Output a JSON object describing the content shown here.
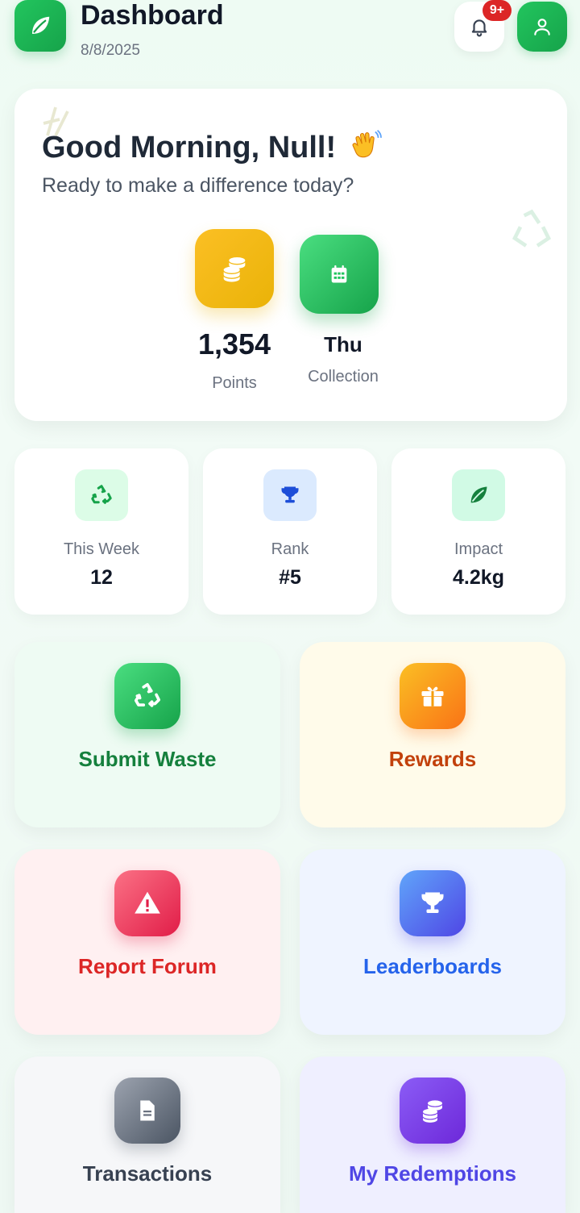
{
  "header": {
    "title": "Dashboard",
    "date": "8/8/2025",
    "notification_badge": "9+"
  },
  "greeting": {
    "title": "Good Morning, Null!",
    "subtitle": "Ready to make a difference today?",
    "points": {
      "value": "1,354",
      "label": "Points"
    },
    "collection": {
      "value": "Thu",
      "label": "Collection"
    }
  },
  "stats": [
    {
      "label": "This Week",
      "value": "12",
      "icon": "recycle-icon"
    },
    {
      "label": "Rank",
      "value": "#5",
      "icon": "trophy-icon"
    },
    {
      "label": "Impact",
      "value": "4.2kg",
      "icon": "leaf-icon"
    }
  ],
  "actions": [
    {
      "label": "Submit Waste",
      "icon": "recycle-icon",
      "color": "#15803d"
    },
    {
      "label": "Rewards",
      "icon": "gift-icon",
      "color": "#c2410c"
    },
    {
      "label": "Report Forum",
      "icon": "warning-icon",
      "color": "#dc2626"
    },
    {
      "label": "Leaderboards",
      "icon": "trophy-icon",
      "color": "#2563eb"
    },
    {
      "label": "Transactions",
      "icon": "document-icon",
      "color": "#374151"
    },
    {
      "label": "My Redemptions",
      "icon": "coins-icon",
      "color": "#4f46e5"
    }
  ],
  "colors": {
    "brand_green": "#16a34a",
    "points_yellow": "#eab308",
    "badge_red": "#dc2626"
  }
}
